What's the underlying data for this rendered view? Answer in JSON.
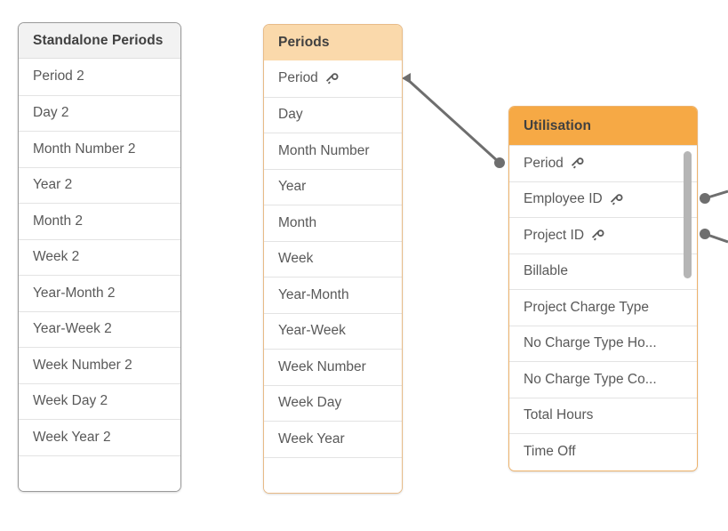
{
  "canvas": {
    "background": "#ffffff",
    "accent_strong": "#f6a945",
    "accent_light": "#fad9ab",
    "neutral_header": "#f2f2f2",
    "link_color": "#6e6e6e"
  },
  "tables": [
    {
      "id": "standalone-periods",
      "title": "Standalone Periods",
      "header_style": "neutral",
      "fields": [
        {
          "name": "Period 2",
          "key": false
        },
        {
          "name": "Day 2",
          "key": false
        },
        {
          "name": "Month Number 2",
          "key": false
        },
        {
          "name": "Year 2",
          "key": false
        },
        {
          "name": "Month 2",
          "key": false
        },
        {
          "name": "Week 2",
          "key": false
        },
        {
          "name": "Year-Month 2",
          "key": false
        },
        {
          "name": "Year-Week 2",
          "key": false
        },
        {
          "name": "Week Number 2",
          "key": false
        },
        {
          "name": "Week Day 2",
          "key": false
        },
        {
          "name": "Week Year 2",
          "key": false
        },
        {
          "name": "",
          "key": false
        }
      ]
    },
    {
      "id": "periods",
      "title": "Periods",
      "header_style": "accent-light",
      "fields": [
        {
          "name": "Period",
          "key": true
        },
        {
          "name": "Day",
          "key": false
        },
        {
          "name": "Month Number",
          "key": false
        },
        {
          "name": "Year",
          "key": false
        },
        {
          "name": "Month",
          "key": false
        },
        {
          "name": "Week",
          "key": false
        },
        {
          "name": "Year-Month",
          "key": false
        },
        {
          "name": "Year-Week",
          "key": false
        },
        {
          "name": "Week Number",
          "key": false
        },
        {
          "name": "Week Day",
          "key": false
        },
        {
          "name": "Week Year",
          "key": false
        },
        {
          "name": "",
          "key": false
        }
      ]
    },
    {
      "id": "utilisation",
      "title": "Utilisation",
      "header_style": "accent-strong",
      "scrollable": true,
      "fields": [
        {
          "name": "Period",
          "key": true
        },
        {
          "name": "Employee ID",
          "key": true
        },
        {
          "name": "Project ID",
          "key": true
        },
        {
          "name": "Billable",
          "key": false
        },
        {
          "name": "Project Charge Type",
          "key": false
        },
        {
          "name": "No Charge Type Ho...",
          "key": false
        },
        {
          "name": "No Charge Type Co...",
          "key": false
        },
        {
          "name": "Total Hours",
          "key": false
        },
        {
          "name": "Time Off",
          "key": false
        }
      ]
    }
  ],
  "icons": {
    "key": "key-icon"
  },
  "links": [
    {
      "id": "periods-to-utilisation",
      "from_table": "periods",
      "from_field": "Period",
      "to_table": "utilisation",
      "to_field": "Period"
    },
    {
      "id": "utilisation-employee-id-out",
      "from_table": "utilisation",
      "from_field": "Employee ID",
      "to_table": "",
      "to_field": ""
    },
    {
      "id": "utilisation-project-id-out",
      "from_table": "utilisation",
      "from_field": "Project ID",
      "to_table": "",
      "to_field": ""
    }
  ]
}
